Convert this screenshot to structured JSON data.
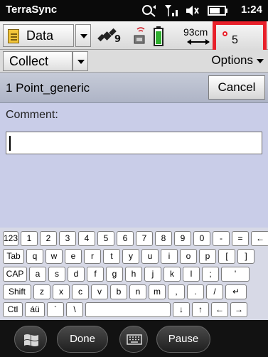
{
  "status": {
    "app_name": "TerraSync",
    "time": "1:24",
    "signal_icon": "signal-icon",
    "volume_icon": "volume-icon",
    "battery_icon": "battery-icon",
    "sync_icon": "sync-icon"
  },
  "toolbar": {
    "data_label": "Data",
    "gnss_satellites": "9",
    "antenna_distance": "93cm",
    "log_count": "5",
    "accent": "#e8202a"
  },
  "mode": {
    "section_label": "Collect",
    "options_label": "Options"
  },
  "form": {
    "feature_title": "1 Point_generic",
    "cancel_label": "Cancel",
    "comment_label": "Comment:",
    "comment_value": ""
  },
  "keyboard": {
    "rows": [
      [
        "123",
        "1",
        "2",
        "3",
        "4",
        "5",
        "6",
        "7",
        "8",
        "9",
        "0",
        "-",
        "=",
        "←"
      ],
      [
        "Tab",
        "q",
        "w",
        "e",
        "r",
        "t",
        "y",
        "u",
        "i",
        "o",
        "p",
        "[",
        "]"
      ],
      [
        "CAP",
        "a",
        "s",
        "d",
        "f",
        "g",
        "h",
        "j",
        "k",
        "l",
        ";",
        "'"
      ],
      [
        "Shift",
        "z",
        "x",
        "c",
        "v",
        "b",
        "n",
        "m",
        ",",
        ".",
        "/",
        "↵"
      ],
      [
        "Ctl",
        "áü",
        "`",
        "\\",
        "",
        "↓",
        "↑",
        "←",
        "→"
      ]
    ]
  },
  "nav": {
    "done_label": "Done",
    "pause_label": "Pause"
  }
}
